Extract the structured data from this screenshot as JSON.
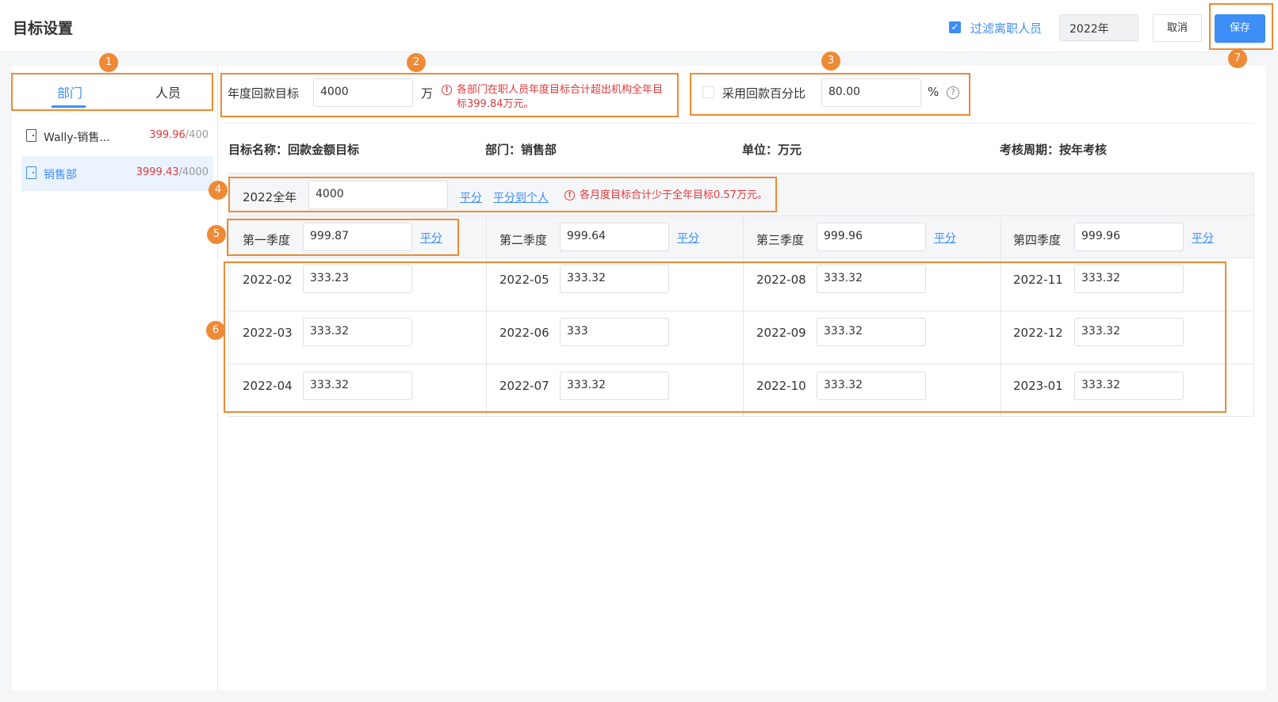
{
  "header": {
    "title": "目标设置",
    "filter_label": "过滤离职人员",
    "filter_checked": true,
    "year": "2022年",
    "cancel": "取消",
    "save": "保存"
  },
  "tabs": [
    "部门",
    "人员"
  ],
  "departments": [
    {
      "name": "Wally-销售...",
      "actual": "399.96",
      "target": "/400",
      "selected": false
    },
    {
      "name": "销售部",
      "actual": "3999.43",
      "target": "/4000",
      "selected": true
    }
  ],
  "annual_target": {
    "label": "年度回款目标",
    "value": "4000",
    "unit": "万",
    "warning_line1": "各部门在职人员年度目标合计超出机构全年目",
    "warning_line2": "标399.84万元。"
  },
  "percent": {
    "label": "采用回款百分比",
    "value": "80.00",
    "unit": "%",
    "checked": false
  },
  "info": {
    "name": "目标名称：回款金额目标",
    "dept": "部门：销售部",
    "unit": "单位：万元",
    "cycle": "考核周期：按年考核"
  },
  "year_row": {
    "label": "2022全年",
    "value": "4000",
    "split": "平分",
    "split_person": "平分到个人",
    "warning": "各月度目标合计少于全年目标0.57万元。"
  },
  "quarters": [
    {
      "label": "第一季度",
      "value": "999.87",
      "split": "平分",
      "months": [
        {
          "m": "2022-02",
          "v": "333.23"
        },
        {
          "m": "2022-03",
          "v": "333.32"
        },
        {
          "m": "2022-04",
          "v": "333.32"
        }
      ]
    },
    {
      "label": "第二季度",
      "value": "999.64",
      "split": "平分",
      "months": [
        {
          "m": "2022-05",
          "v": "333.32"
        },
        {
          "m": "2022-06",
          "v": "333"
        },
        {
          "m": "2022-07",
          "v": "333.32"
        }
      ]
    },
    {
      "label": "第三季度",
      "value": "999.96",
      "split": "平分",
      "months": [
        {
          "m": "2022-08",
          "v": "333.32"
        },
        {
          "m": "2022-09",
          "v": "333.32"
        },
        {
          "m": "2022-10",
          "v": "333.32"
        }
      ]
    },
    {
      "label": "第四季度",
      "value": "999.96",
      "split": "平分",
      "months": [
        {
          "m": "2022-11",
          "v": "333.32"
        },
        {
          "m": "2022-12",
          "v": "333.32"
        },
        {
          "m": "2023-01",
          "v": "333.32"
        }
      ]
    }
  ],
  "callouts": [
    "1",
    "2",
    "3",
    "4",
    "5",
    "6",
    "7"
  ],
  "colors": {
    "accent": "#3d8ef6",
    "warning": "#e4393c",
    "callout": "#ee8a35"
  }
}
